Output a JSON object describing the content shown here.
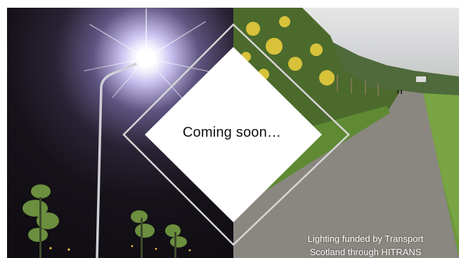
{
  "banner": {
    "headline": "Coming soon…",
    "caption_line1": "Lighting funded by Transport",
    "caption_line2": "Scotland through HITRANS",
    "colors": {
      "diamond_fill": "#ffffff",
      "diamond_outline": "#d6d6d6",
      "caption_text": "#ffffff",
      "night_sky": "#120f14",
      "path_surface": "#8a8780",
      "grass": "#6f9a3c",
      "gorse_flowers": "#d8c23a"
    },
    "images": [
      {
        "name": "street-lamp-at-night-photo",
        "alt": ""
      },
      {
        "name": "lit-cycle-path-daytime-photo",
        "alt": ""
      }
    ]
  }
}
